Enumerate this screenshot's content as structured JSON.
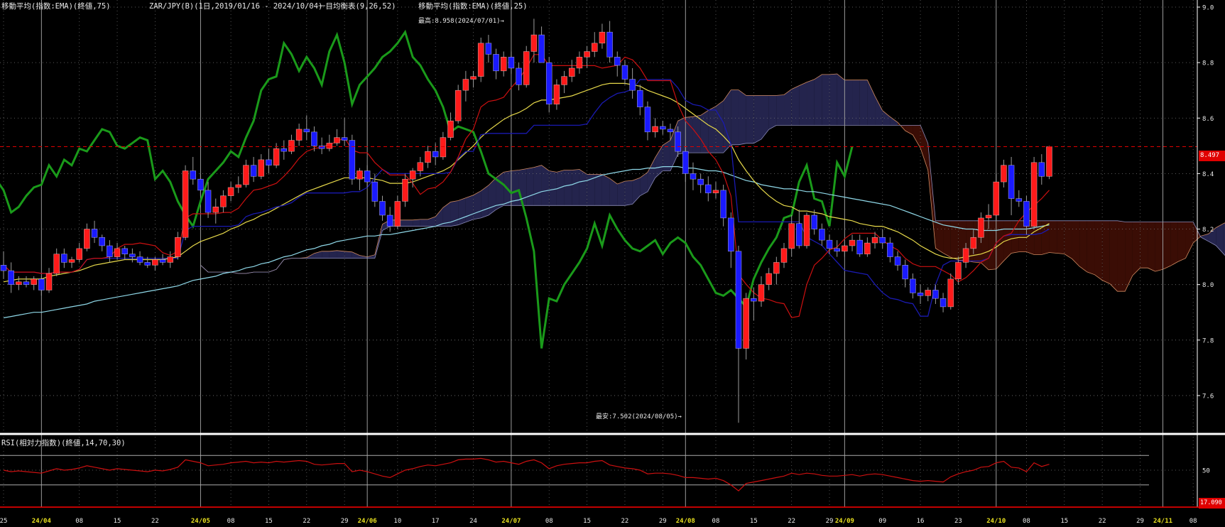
{
  "header": {
    "ema75": "移動平均(指数:EMA)(終値,75)",
    "symbol": "ZAR/JPY(B)(1日,2019/01/16 - 2024/10/04)",
    "ichimoku": "一目均衡表(9,26,52)",
    "ema25": "移動平均(指数:EMA)(終値,25)"
  },
  "annotations": {
    "high": "最高:8.958(2024/07/01)→",
    "low": "最安:7.502(2024/08/05)→"
  },
  "rsi_header": "RSI(相対力指数)(終値,14,70,30)",
  "current_price_label": "8.497",
  "rsi_value_label": "17.090",
  "colors": {
    "background": "#000000",
    "candle_up": "#ff1a1a",
    "candle_down": "#1a1aff",
    "ema25": "#e6d84a",
    "ema75": "#8fd8e8",
    "tenkan": "#cc1010",
    "kijun": "#1a1ab0",
    "chikou": "#1a9a1a",
    "kumo_bear": "#3a0d05",
    "kumo_bull": "#24244d",
    "rsi": "#cc1010"
  },
  "chart_data": {
    "type": "candlestick",
    "price_axis": {
      "min": 7.5,
      "max": 9.0,
      "ticks": [
        "9.0",
        "8.8",
        "8.6",
        "8.4",
        "8.2",
        "8.0",
        "7.8",
        "7.6"
      ]
    },
    "rsi_axis": {
      "min": 0,
      "max": 100,
      "ticks": [
        "50"
      ],
      "levels": [
        70,
        30
      ]
    },
    "x_labels": [
      {
        "t": "25",
        "i": 0,
        "m": false
      },
      {
        "t": "24/04",
        "i": 5,
        "m": true
      },
      {
        "t": "08",
        "i": 10,
        "m": false
      },
      {
        "t": "15",
        "i": 15,
        "m": false
      },
      {
        "t": "22",
        "i": 20,
        "m": false
      },
      {
        "t": "24/05",
        "i": 26,
        "m": true
      },
      {
        "t": "08",
        "i": 30,
        "m": false
      },
      {
        "t": "15",
        "i": 35,
        "m": false
      },
      {
        "t": "22",
        "i": 40,
        "m": false
      },
      {
        "t": "29",
        "i": 45,
        "m": false
      },
      {
        "t": "24/06",
        "i": 48,
        "m": true
      },
      {
        "t": "10",
        "i": 52,
        "m": false
      },
      {
        "t": "17",
        "i": 57,
        "m": false
      },
      {
        "t": "24",
        "i": 62,
        "m": false
      },
      {
        "t": "24/07",
        "i": 67,
        "m": true
      },
      {
        "t": "08",
        "i": 72,
        "m": false
      },
      {
        "t": "15",
        "i": 77,
        "m": false
      },
      {
        "t": "22",
        "i": 82,
        "m": false
      },
      {
        "t": "29",
        "i": 87,
        "m": false
      },
      {
        "t": "24/08",
        "i": 90,
        "m": true
      },
      {
        "t": "08",
        "i": 94,
        "m": false
      },
      {
        "t": "15",
        "i": 99,
        "m": false
      },
      {
        "t": "22",
        "i": 104,
        "m": false
      },
      {
        "t": "29",
        "i": 109,
        "m": false
      },
      {
        "t": "24/09",
        "i": 111,
        "m": true
      },
      {
        "t": "09",
        "i": 116,
        "m": false
      },
      {
        "t": "16",
        "i": 121,
        "m": false
      },
      {
        "t": "23",
        "i": 126,
        "m": false
      },
      {
        "t": "24/10",
        "i": 131,
        "m": true
      },
      {
        "t": "08",
        "i": 135,
        "m": false
      },
      {
        "t": "15",
        "i": 140,
        "m": false
      },
      {
        "t": "22",
        "i": 145,
        "m": false
      },
      {
        "t": "29",
        "i": 150,
        "m": false
      },
      {
        "t": "24/11",
        "i": 153,
        "m": true
      },
      {
        "t": "08",
        "i": 157,
        "m": false
      }
    ],
    "candles": [
      [
        8.07,
        8.12,
        8.02,
        8.05
      ],
      [
        8.05,
        8.08,
        7.97,
        8.0
      ],
      [
        8.0,
        8.03,
        7.98,
        8.01
      ],
      [
        8.01,
        8.03,
        7.99,
        8.0
      ],
      [
        8.0,
        8.03,
        7.98,
        8.02
      ],
      [
        8.02,
        8.03,
        7.96,
        7.98
      ],
      [
        7.98,
        8.06,
        7.97,
        8.04
      ],
      [
        8.04,
        8.13,
        8.03,
        8.11
      ],
      [
        8.11,
        8.13,
        8.06,
        8.08
      ],
      [
        8.08,
        8.1,
        8.06,
        8.09
      ],
      [
        8.09,
        8.15,
        8.08,
        8.13
      ],
      [
        8.13,
        8.22,
        8.12,
        8.2
      ],
      [
        8.2,
        8.23,
        8.15,
        8.17
      ],
      [
        8.17,
        8.18,
        8.12,
        8.14
      ],
      [
        8.14,
        8.16,
        8.08,
        8.1
      ],
      [
        8.1,
        8.15,
        8.09,
        8.13
      ],
      [
        8.13,
        8.14,
        8.09,
        8.11
      ],
      [
        8.11,
        8.13,
        8.08,
        8.1
      ],
      [
        8.1,
        8.12,
        8.07,
        8.08
      ],
      [
        8.08,
        8.1,
        8.06,
        8.07
      ],
      [
        8.07,
        8.1,
        8.05,
        8.09
      ],
      [
        8.09,
        8.11,
        8.07,
        8.08
      ],
      [
        8.08,
        8.12,
        8.06,
        8.1
      ],
      [
        8.1,
        8.19,
        8.09,
        8.17
      ],
      [
        8.17,
        8.43,
        8.16,
        8.41
      ],
      [
        8.41,
        8.46,
        8.36,
        8.38
      ],
      [
        8.38,
        8.4,
        8.32,
        8.34
      ],
      [
        8.34,
        8.37,
        8.24,
        8.26
      ],
      [
        8.26,
        8.31,
        8.22,
        8.28
      ],
      [
        8.28,
        8.34,
        8.26,
        8.32
      ],
      [
        8.32,
        8.37,
        8.3,
        8.35
      ],
      [
        8.35,
        8.39,
        8.33,
        8.36
      ],
      [
        8.36,
        8.45,
        8.35,
        8.43
      ],
      [
        8.43,
        8.46,
        8.37,
        8.39
      ],
      [
        8.39,
        8.47,
        8.38,
        8.45
      ],
      [
        8.45,
        8.49,
        8.4,
        8.43
      ],
      [
        8.43,
        8.51,
        8.42,
        8.49
      ],
      [
        8.49,
        8.52,
        8.45,
        8.48
      ],
      [
        8.48,
        8.54,
        8.47,
        8.52
      ],
      [
        8.52,
        8.58,
        8.5,
        8.56
      ],
      [
        8.56,
        8.61,
        8.52,
        8.55
      ],
      [
        8.55,
        8.57,
        8.48,
        8.5
      ],
      [
        8.5,
        8.53,
        8.47,
        8.49
      ],
      [
        8.49,
        8.54,
        8.48,
        8.51
      ],
      [
        8.51,
        8.56,
        8.5,
        8.53
      ],
      [
        8.53,
        8.6,
        8.5,
        8.52
      ],
      [
        8.52,
        8.54,
        8.36,
        8.38
      ],
      [
        8.38,
        8.42,
        8.34,
        8.41
      ],
      [
        8.41,
        8.43,
        8.35,
        8.37
      ],
      [
        8.37,
        8.4,
        8.28,
        8.3
      ],
      [
        8.3,
        8.32,
        8.23,
        8.25
      ],
      [
        8.25,
        8.28,
        8.19,
        8.21
      ],
      [
        8.21,
        8.32,
        8.2,
        8.3
      ],
      [
        8.3,
        8.4,
        8.28,
        8.38
      ],
      [
        8.38,
        8.42,
        8.35,
        8.41
      ],
      [
        8.41,
        8.46,
        8.39,
        8.44
      ],
      [
        8.44,
        8.5,
        8.42,
        8.48
      ],
      [
        8.48,
        8.51,
        8.43,
        8.46
      ],
      [
        8.46,
        8.55,
        8.45,
        8.53
      ],
      [
        8.53,
        8.62,
        8.52,
        8.59
      ],
      [
        8.59,
        8.72,
        8.58,
        8.7
      ],
      [
        8.7,
        8.77,
        8.66,
        8.74
      ],
      [
        8.74,
        8.77,
        8.71,
        8.75
      ],
      [
        8.75,
        8.89,
        8.73,
        8.87
      ],
      [
        8.87,
        8.9,
        8.8,
        8.83
      ],
      [
        8.83,
        8.85,
        8.74,
        8.77
      ],
      [
        8.77,
        8.84,
        8.75,
        8.82
      ],
      [
        8.82,
        8.84,
        8.76,
        8.78
      ],
      [
        8.78,
        8.8,
        8.7,
        8.72
      ],
      [
        8.72,
        8.86,
        8.71,
        8.84
      ],
      [
        8.84,
        8.958,
        8.8,
        8.9
      ],
      [
        8.9,
        8.93,
        8.8,
        8.8
      ],
      [
        8.8,
        8.82,
        8.62,
        8.65
      ],
      [
        8.65,
        8.74,
        8.63,
        8.72
      ],
      [
        8.72,
        8.77,
        8.69,
        8.75
      ],
      [
        8.75,
        8.81,
        8.73,
        8.78
      ],
      [
        8.78,
        8.84,
        8.76,
        8.82
      ],
      [
        8.82,
        8.86,
        8.78,
        8.84
      ],
      [
        8.84,
        8.91,
        8.82,
        8.87
      ],
      [
        8.87,
        8.94,
        8.85,
        8.91
      ],
      [
        8.91,
        8.95,
        8.8,
        8.82
      ],
      [
        8.82,
        8.84,
        8.75,
        8.79
      ],
      [
        8.79,
        8.81,
        8.72,
        8.74
      ],
      [
        8.74,
        8.78,
        8.67,
        8.7
      ],
      [
        8.7,
        8.72,
        8.61,
        8.64
      ],
      [
        8.64,
        8.66,
        8.52,
        8.55
      ],
      [
        8.55,
        8.6,
        8.53,
        8.57
      ],
      [
        8.57,
        8.59,
        8.54,
        8.56
      ],
      [
        8.56,
        8.58,
        8.52,
        8.55
      ],
      [
        8.55,
        8.57,
        8.46,
        8.48
      ],
      [
        8.48,
        8.5,
        8.37,
        8.4
      ],
      [
        8.4,
        8.44,
        8.34,
        8.38
      ],
      [
        8.38,
        8.4,
        8.33,
        8.36
      ],
      [
        8.36,
        8.39,
        8.3,
        8.33
      ],
      [
        8.33,
        8.37,
        8.31,
        8.34
      ],
      [
        8.34,
        8.36,
        8.21,
        8.24
      ],
      [
        8.24,
        8.26,
        8.06,
        8.12
      ],
      [
        8.12,
        8.14,
        7.502,
        7.77
      ],
      [
        7.77,
        7.97,
        7.73,
        7.95
      ],
      [
        7.95,
        7.99,
        7.87,
        7.94
      ],
      [
        7.94,
        8.03,
        7.92,
        8.0
      ],
      [
        8.0,
        8.06,
        7.98,
        8.04
      ],
      [
        8.04,
        8.1,
        8.0,
        8.08
      ],
      [
        8.08,
        8.15,
        8.06,
        8.13
      ],
      [
        8.13,
        8.25,
        8.1,
        8.22
      ],
      [
        8.22,
        8.27,
        8.13,
        8.14
      ],
      [
        8.14,
        8.26,
        8.13,
        8.25
      ],
      [
        8.25,
        8.27,
        8.18,
        8.2
      ],
      [
        8.2,
        8.22,
        8.14,
        8.16
      ],
      [
        8.16,
        8.18,
        8.11,
        8.13
      ],
      [
        8.13,
        8.16,
        8.1,
        8.12
      ],
      [
        8.12,
        8.16,
        8.1,
        8.14
      ],
      [
        8.14,
        8.18,
        8.12,
        8.16
      ],
      [
        8.16,
        8.18,
        8.1,
        8.11
      ],
      [
        8.11,
        8.17,
        8.1,
        8.15
      ],
      [
        8.15,
        8.19,
        8.13,
        8.17
      ],
      [
        8.17,
        8.2,
        8.13,
        8.15
      ],
      [
        8.15,
        8.17,
        8.08,
        8.1
      ],
      [
        8.1,
        8.12,
        8.05,
        8.07
      ],
      [
        8.07,
        8.09,
        7.99,
        8.02
      ],
      [
        8.02,
        8.04,
        7.95,
        7.97
      ],
      [
        7.97,
        8.0,
        7.93,
        7.96
      ],
      [
        7.96,
        7.99,
        7.94,
        7.98
      ],
      [
        7.98,
        8.0,
        7.93,
        7.95
      ],
      [
        7.95,
        7.97,
        7.9,
        7.92
      ],
      [
        7.92,
        8.04,
        7.91,
        8.02
      ],
      [
        8.02,
        8.1,
        8.0,
        8.08
      ],
      [
        8.08,
        8.15,
        8.06,
        8.13
      ],
      [
        8.13,
        8.2,
        8.11,
        8.17
      ],
      [
        8.17,
        8.26,
        8.15,
        8.24
      ],
      [
        8.24,
        8.29,
        8.2,
        8.25
      ],
      [
        8.25,
        8.4,
        8.23,
        8.37
      ],
      [
        8.37,
        8.45,
        8.35,
        8.43
      ],
      [
        8.43,
        8.46,
        8.25,
        8.31
      ],
      [
        8.31,
        8.34,
        8.28,
        8.3
      ],
      [
        8.3,
        8.32,
        8.18,
        8.21
      ],
      [
        8.21,
        8.46,
        8.2,
        8.44
      ],
      [
        8.44,
        8.47,
        8.36,
        8.39
      ],
      [
        8.39,
        8.5,
        8.38,
        8.497
      ]
    ],
    "series": {
      "ema25": [
        8.01,
        8.015,
        8.02,
        8.02,
        8.02,
        8.02,
        8.03,
        8.035,
        8.04,
        8.045,
        8.05,
        8.06,
        8.07,
        8.075,
        8.08,
        8.085,
        8.09,
        8.09,
        8.09,
        8.09,
        8.09,
        8.09,
        8.095,
        8.1,
        8.12,
        8.14,
        8.155,
        8.165,
        8.175,
        8.185,
        8.2,
        8.21,
        8.225,
        8.235,
        8.25,
        8.26,
        8.275,
        8.29,
        8.305,
        8.32,
        8.335,
        8.345,
        8.355,
        8.365,
        8.375,
        8.385,
        8.385,
        8.385,
        8.385,
        8.38,
        8.375,
        8.365,
        8.365,
        8.365,
        8.37,
        8.38,
        8.39,
        8.4,
        8.41,
        8.425,
        8.45,
        8.475,
        8.5,
        8.53,
        8.555,
        8.575,
        8.595,
        8.61,
        8.62,
        8.635,
        8.655,
        8.665,
        8.665,
        8.67,
        8.675,
        8.68,
        8.69,
        8.7,
        8.71,
        8.72,
        8.725,
        8.725,
        8.725,
        8.72,
        8.715,
        8.7,
        8.69,
        8.68,
        8.67,
        8.655,
        8.635,
        8.615,
        8.595,
        8.575,
        8.56,
        8.535,
        8.505,
        8.45,
        8.41,
        8.375,
        8.345,
        8.32,
        8.3,
        8.285,
        8.28,
        8.265,
        8.265,
        8.26,
        8.255,
        8.245,
        8.24,
        8.235,
        8.23,
        8.22,
        8.215,
        8.21,
        8.21,
        8.2,
        8.19,
        8.175,
        8.16,
        8.14,
        8.125,
        8.11,
        8.1,
        8.095,
        8.095,
        8.1,
        8.105,
        8.11,
        8.12,
        8.135,
        8.155,
        8.165,
        8.17,
        8.17,
        8.19,
        8.205,
        8.22
      ],
      "ema75": [
        7.88,
        7.885,
        7.89,
        7.895,
        7.9,
        7.9,
        7.905,
        7.91,
        7.915,
        7.92,
        7.925,
        7.93,
        7.94,
        7.945,
        7.95,
        7.955,
        7.96,
        7.965,
        7.97,
        7.975,
        7.98,
        7.985,
        7.99,
        7.995,
        8.005,
        8.015,
        8.02,
        8.025,
        8.03,
        8.04,
        8.045,
        8.05,
        8.06,
        8.065,
        8.075,
        8.08,
        8.09,
        8.1,
        8.105,
        8.115,
        8.125,
        8.13,
        8.14,
        8.145,
        8.155,
        8.16,
        8.165,
        8.17,
        8.175,
        8.175,
        8.18,
        8.18,
        8.185,
        8.19,
        8.195,
        8.2,
        8.205,
        8.21,
        8.22,
        8.225,
        8.235,
        8.245,
        8.255,
        8.265,
        8.275,
        8.285,
        8.29,
        8.3,
        8.305,
        8.315,
        8.325,
        8.335,
        8.34,
        8.345,
        8.355,
        8.36,
        8.37,
        8.375,
        8.385,
        8.395,
        8.4,
        8.405,
        8.41,
        8.415,
        8.415,
        8.42,
        8.42,
        8.425,
        8.425,
        8.425,
        8.42,
        8.42,
        8.415,
        8.41,
        8.41,
        8.405,
        8.395,
        8.385,
        8.375,
        8.37,
        8.36,
        8.355,
        8.35,
        8.345,
        8.345,
        8.34,
        8.335,
        8.335,
        8.33,
        8.325,
        8.32,
        8.315,
        8.31,
        8.305,
        8.3,
        8.295,
        8.29,
        8.285,
        8.275,
        8.265,
        8.255,
        8.245,
        8.235,
        8.225,
        8.215,
        8.21,
        8.205,
        8.2,
        8.2,
        8.195,
        8.195,
        8.195,
        8.2,
        8.2,
        8.2,
        8.2,
        8.205,
        8.21,
        8.215
      ],
      "rsi": [
        50,
        48,
        49,
        48,
        47,
        46,
        49,
        52,
        50,
        51,
        53,
        56,
        54,
        52,
        50,
        52,
        51,
        50,
        49,
        48,
        50,
        49,
        51,
        54,
        64,
        62,
        60,
        56,
        57,
        58,
        60,
        61,
        62,
        60,
        61,
        60,
        62,
        61,
        62,
        63,
        62,
        58,
        57,
        58,
        59,
        59,
        48,
        50,
        48,
        45,
        42,
        40,
        45,
        50,
        52,
        55,
        57,
        56,
        58,
        60,
        64,
        65,
        65,
        66,
        64,
        61,
        62,
        60,
        58,
        62,
        64,
        60,
        52,
        56,
        58,
        59,
        60,
        60,
        62,
        63,
        57,
        55,
        53,
        52,
        50,
        45,
        46,
        46,
        45,
        43,
        40,
        40,
        39,
        38,
        39,
        36,
        30,
        22,
        32,
        34,
        36,
        38,
        40,
        42,
        46,
        44,
        46,
        45,
        43,
        42,
        42,
        43,
        44,
        42,
        44,
        45,
        44,
        42,
        40,
        38,
        36,
        35,
        36,
        35,
        34,
        41,
        45,
        48,
        50,
        54,
        55,
        60,
        62,
        54,
        53,
        48,
        60,
        55,
        58
      ]
    }
  }
}
